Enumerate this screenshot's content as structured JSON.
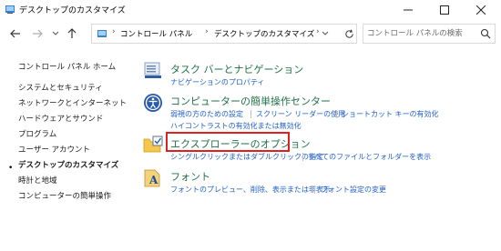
{
  "window": {
    "title": "デスクトップのカスタマイズ"
  },
  "address": {
    "crumbs": [
      "コントロール パネル",
      "デスクトップのカスタマイズ"
    ]
  },
  "search": {
    "placeholder": "コントロール パネルの検索"
  },
  "sidebar": {
    "home": "コントロール パネル ホーム",
    "items": [
      "システムとセキュリティ",
      "ネットワークとインターネット",
      "ハードウェアとサウンド",
      "プログラム",
      "ユーザー アカウント",
      "デスクトップのカスタマイズ",
      "時計と地域",
      "コンピューターの簡単操作"
    ],
    "current_index": 5
  },
  "categories": [
    {
      "title": "タスク バーとナビゲーション",
      "icon": "taskbar-icon",
      "links": [
        "ナビゲーションのプロパティ"
      ]
    },
    {
      "title": "コンピューターの簡単操作センター",
      "icon": "ease-of-access-icon",
      "links": [
        "弱視の方のための設定",
        "スクリーン リーダーの使用",
        "ショートカット キーの有効化",
        "ハイコントラストの有効化または無効化"
      ]
    },
    {
      "title": "エクスプローラーのオプション",
      "icon": "folder-options-icon",
      "links": [
        "シングルクリックまたはダブルクリックの指定",
        "すべてのファイルとフォルダーを表示"
      ]
    },
    {
      "title": "フォント",
      "icon": "font-icon",
      "links": [
        "フォントのプレビュー、削除、表示または非表示",
        "フォント設定の変更"
      ]
    }
  ],
  "colors": {
    "category_title": "#1e7145",
    "link": "#1f5fc8",
    "highlight": "#e02020"
  }
}
